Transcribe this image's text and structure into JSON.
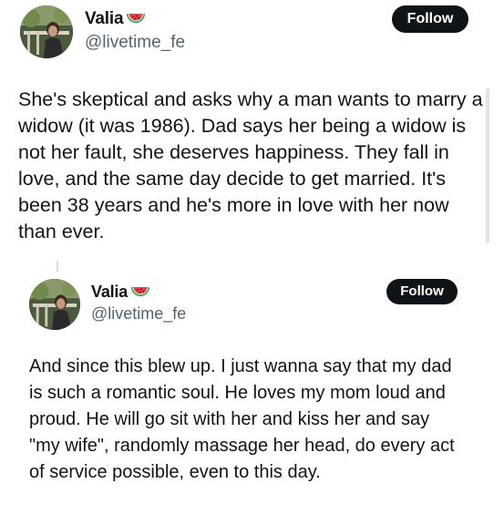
{
  "posts": [
    {
      "author": {
        "display_name": "Valia",
        "emoji_icon": "watermelon-icon",
        "handle": "@livetime_fe"
      },
      "follow_label": "Follow",
      "text": "She's skeptical and asks why a man wants to marry a widow (it was 1986). Dad says her being a widow is not her fault, she deserves happiness. They fall in love, and the same day decide to get married. It's been 38 years and he's more in love with her now than ever."
    },
    {
      "author": {
        "display_name": "Valia",
        "emoji_icon": "watermelon-icon",
        "handle": "@livetime_fe"
      },
      "follow_label": "Follow",
      "text": "And since this blew up. I just wanna say that my dad is such a romantic soul. He loves my mom loud and proud. He will go sit with her and kiss her and say \"my wife\", randomly massage her head, do every act of service possible, even to this day."
    }
  ],
  "colors": {
    "text": "#0f1419",
    "handle": "#536471",
    "follow_bg": "#0f1419",
    "follow_text": "#ffffff"
  }
}
